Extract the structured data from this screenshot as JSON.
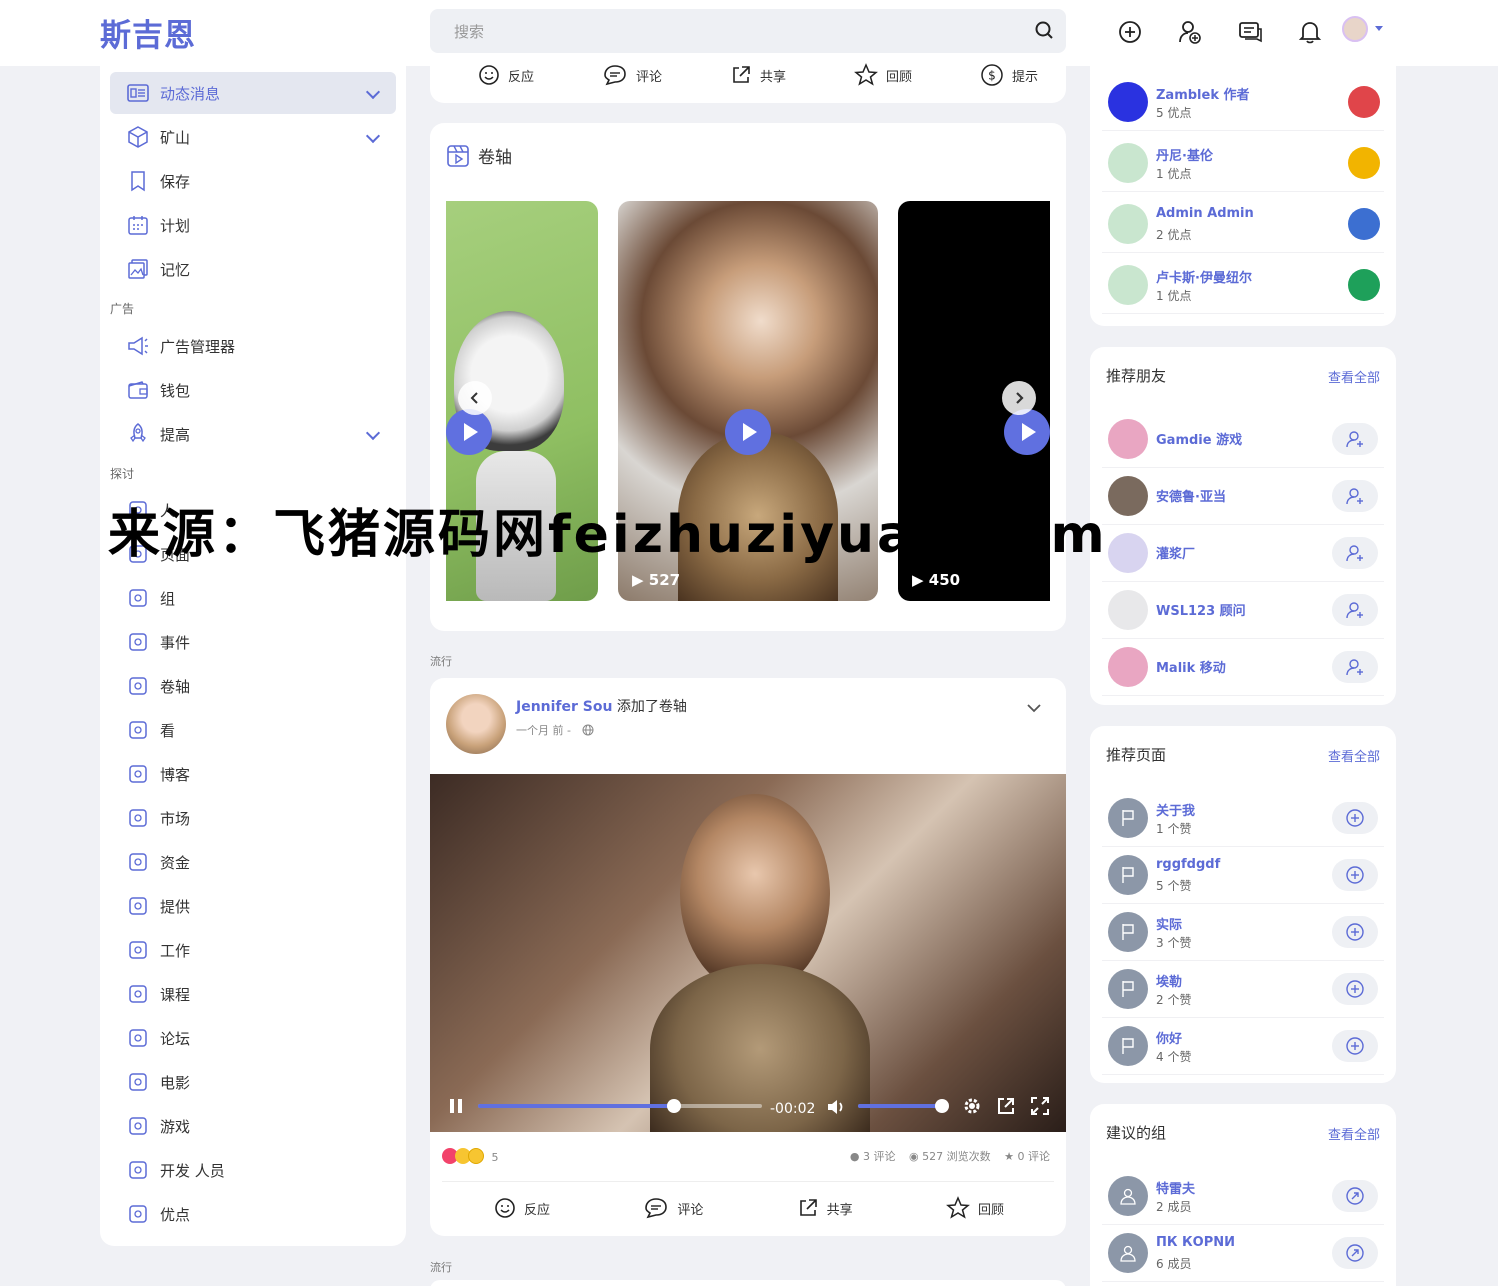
{
  "app": {
    "logo": "斯吉恩"
  },
  "search": {
    "placeholder": "搜索"
  },
  "sidebar": {
    "items": [
      {
        "label": "动态消息",
        "icon": "newsfeed-icon",
        "active": true,
        "chevron": true
      },
      {
        "label": "矿山",
        "icon": "cube-icon",
        "chevron": true
      },
      {
        "label": "保存",
        "icon": "bookmark-icon"
      },
      {
        "label": "计划",
        "icon": "calendar-icon"
      },
      {
        "label": "记忆",
        "icon": "memories-icon"
      }
    ],
    "section_ads": "广告",
    "ads_items": [
      {
        "label": "广告管理器",
        "icon": "megaphone-icon"
      },
      {
        "label": "钱包",
        "icon": "wallet-icon"
      },
      {
        "label": "提高",
        "icon": "rocket-icon",
        "chevron": true
      }
    ],
    "section_explore": "探讨",
    "explore_items": [
      {
        "label": "人",
        "icon": "people-icon"
      },
      {
        "label": "页面",
        "icon": "flag-icon"
      },
      {
        "label": "组",
        "icon": "group-icon"
      },
      {
        "label": "事件",
        "icon": "calendar-icon"
      },
      {
        "label": "卷轴",
        "icon": "reels-icon"
      },
      {
        "label": "看",
        "icon": "watch-icon"
      },
      {
        "label": "博客",
        "icon": "blog-icon"
      },
      {
        "label": "市场",
        "icon": "store-icon"
      },
      {
        "label": "资金",
        "icon": "funding-icon"
      },
      {
        "label": "提供",
        "icon": "offer-icon"
      },
      {
        "label": "工作",
        "icon": "briefcase-icon"
      },
      {
        "label": "课程",
        "icon": "course-icon"
      },
      {
        "label": "论坛",
        "icon": "forum-icon"
      },
      {
        "label": "电影",
        "icon": "movie-icon"
      },
      {
        "label": "游戏",
        "icon": "game-icon"
      },
      {
        "label": "开发 人员",
        "icon": "code-icon"
      },
      {
        "label": "优点",
        "icon": "points-icon"
      }
    ]
  },
  "top_actions": [
    "反应",
    "评论",
    "共享",
    "回顾",
    "提示"
  ],
  "reels": {
    "title": "卷轴",
    "items": [
      {
        "views": "",
        "theme": "green"
      },
      {
        "views": "527",
        "theme": "party"
      },
      {
        "views": "450",
        "theme": "black"
      }
    ]
  },
  "trending_label": "流行",
  "post": {
    "author": "Jennifer Sou",
    "action": "添加了卷轴",
    "time": "一个月 前 -",
    "video_time": "-00:02",
    "progress": 0.69,
    "volume": 1.0,
    "reaction_count": "5",
    "comments_count": "3 评论",
    "views_count": "527 浏览次数",
    "reviews_count": "0 评论",
    "actions": [
      "反应",
      "评论",
      "共享",
      "回顾"
    ]
  },
  "points_list": [
    {
      "name": "Zamblek 作者",
      "sub": "5 优点",
      "color": "#2a32e0",
      "badge": "#e0454a"
    },
    {
      "name": "丹尼·基伦",
      "sub": "1 优点",
      "color": "#c9e6cf",
      "badge": "#f2b400"
    },
    {
      "name": "Admin Admin",
      "sub": "2 优点",
      "color": "#c9e6cf",
      "badge": "#3c6fd1"
    },
    {
      "name": "卢卡斯·伊曼纽尔",
      "sub": "1 优点",
      "color": "#c9e6cf",
      "badge": "#1ea05a"
    }
  ],
  "recommended_friends": {
    "title": "推荐朋友",
    "see_all": "查看全部",
    "items": [
      {
        "name": "Gamdie 游戏",
        "color": "#e9a6c2"
      },
      {
        "name": "安德鲁·亚当",
        "color": "#7a6a5e"
      },
      {
        "name": "灌浆厂",
        "color": "#d8d4f0"
      },
      {
        "name": "WSL123 顾问",
        "color": "#e8e8ea"
      },
      {
        "name": "Malik 移动",
        "color": "#e9a6c2"
      }
    ]
  },
  "recommended_pages": {
    "title": "推荐页面",
    "see_all": "查看全部",
    "items": [
      {
        "name": "关于我",
        "sub": "1 个赞"
      },
      {
        "name": "rggfdgdf",
        "sub": "5 个赞"
      },
      {
        "name": "实际",
        "sub": "3 个赞"
      },
      {
        "name": "埃勒",
        "sub": "2 个赞"
      },
      {
        "name": "你好",
        "sub": "4 个赞"
      }
    ]
  },
  "suggested_groups": {
    "title": "建议的组",
    "see_all": "查看全部",
    "items": [
      {
        "name": "特雷夫",
        "sub": "2 成员"
      },
      {
        "name": "ПК КОРNИ",
        "sub": "6 成员"
      }
    ]
  },
  "watermark": "来源：飞猪源码网feizhuziyuan.com"
}
